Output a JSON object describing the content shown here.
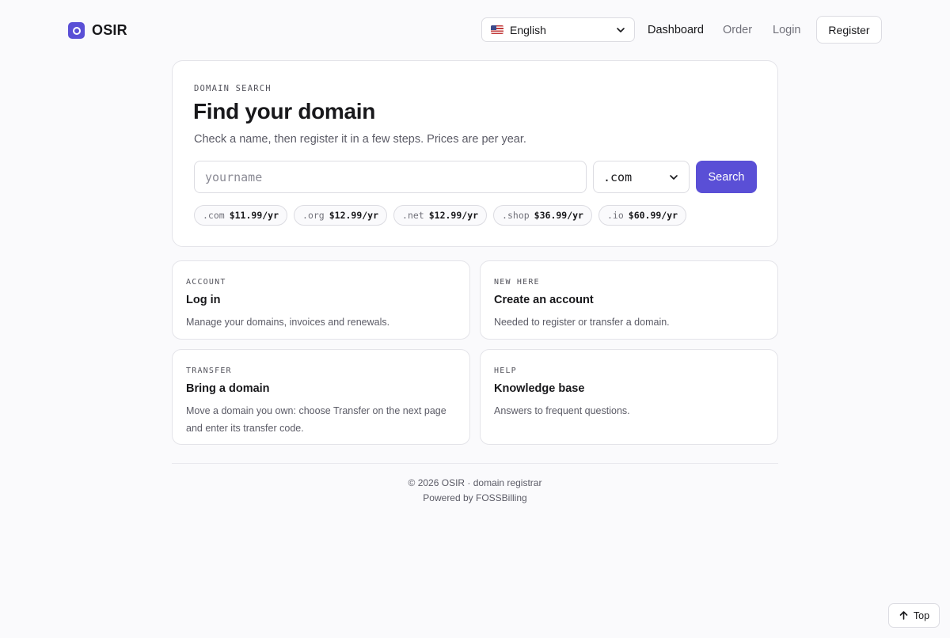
{
  "brand": {
    "name": "OSIR"
  },
  "header": {
    "language": {
      "selected": "English",
      "flag": "us-flag-icon"
    },
    "nav": {
      "dashboard": "Dashboard",
      "order": "Order",
      "login": "Login",
      "register": "Register"
    }
  },
  "search": {
    "eyebrow": "DOMAIN SEARCH",
    "title": "Find your domain",
    "subtitle": "Check a name, then register it in a few steps. Prices are per year.",
    "input_placeholder": "yourname",
    "input_value": "",
    "tld_selected": ".com",
    "button_label": "Search",
    "prices": [
      {
        "tld": ".com",
        "price": "$11.99/yr"
      },
      {
        "tld": ".org",
        "price": "$12.99/yr"
      },
      {
        "tld": ".net",
        "price": "$12.99/yr"
      },
      {
        "tld": ".shop",
        "price": "$36.99/yr"
      },
      {
        "tld": ".io",
        "price": "$60.99/yr"
      }
    ]
  },
  "cards": [
    {
      "eyebrow": "ACCOUNT",
      "title": "Log in",
      "description": "Manage your domains, invoices and renewals."
    },
    {
      "eyebrow": "NEW HERE",
      "title": "Create an account",
      "description": "Needed to register or transfer a domain."
    },
    {
      "eyebrow": "TRANSFER",
      "title": "Bring a domain",
      "description": "Move a domain you own: choose Transfer on the next page and enter its transfer code."
    },
    {
      "eyebrow": "HELP",
      "title": "Knowledge base",
      "description": "Answers to frequent questions."
    }
  ],
  "footer": {
    "copyright": "© 2026 OSIR · domain registrar",
    "powered": "Powered by FOSSBilling"
  },
  "back_to_top": {
    "label": "Top",
    "icon": "arrow-up-icon"
  },
  "colors": {
    "accent": "#5a4fd6",
    "background": "#fafafc",
    "border": "#e4e4e9"
  }
}
